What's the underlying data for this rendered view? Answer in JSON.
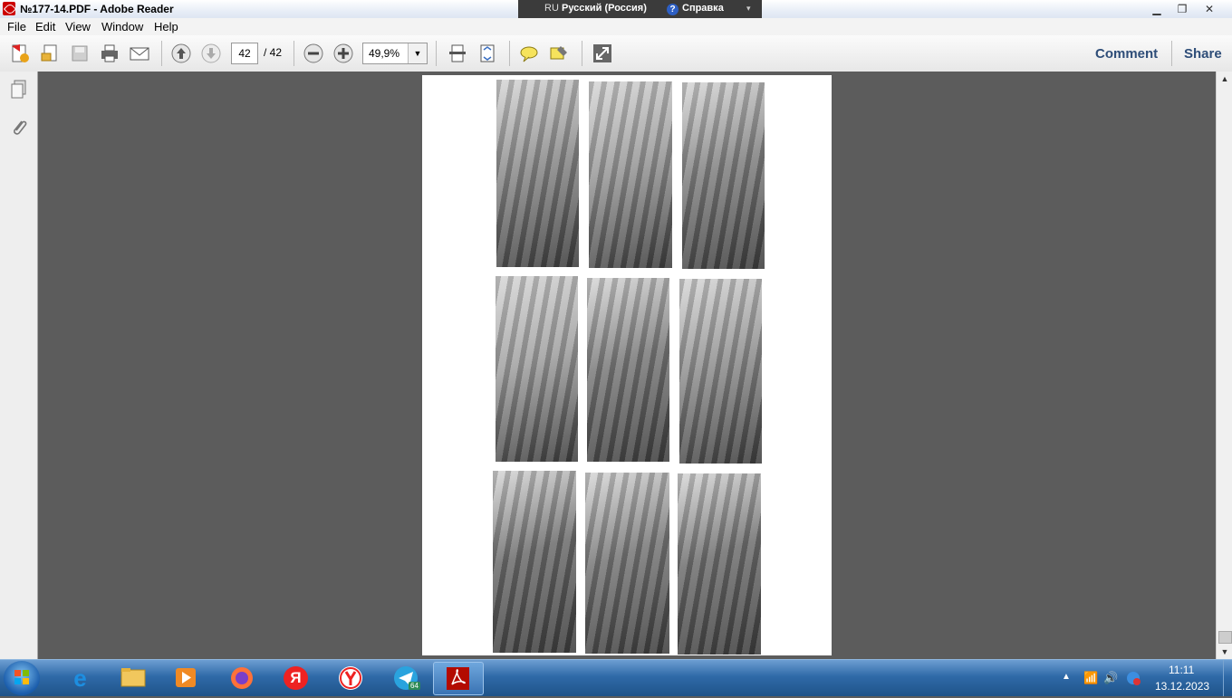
{
  "window": {
    "title": "№177-14.PDF - Adobe Reader",
    "language_code": "RU",
    "language_name": "Русский (Россия)",
    "help_label": "Справка"
  },
  "menu": [
    "File",
    "Edit",
    "View",
    "Window",
    "Help"
  ],
  "toolbar": {
    "current_page": "42",
    "page_total": "/ 42",
    "zoom": "49,9%",
    "comment_label": "Comment",
    "share_label": "Share"
  },
  "photos": [
    {
      "subject": "bus-interior-seats",
      "tone": "#8d8d8d"
    },
    {
      "subject": "metal-plate",
      "tone": "#9a9a9a"
    },
    {
      "subject": "bus-interior-seats",
      "tone": "#848484"
    },
    {
      "subject": "driver-cabin",
      "tone": "#a2a2a2"
    },
    {
      "subject": "engine-bay",
      "tone": "#7d7d7d"
    },
    {
      "subject": "door-panel",
      "tone": "#929292"
    },
    {
      "subject": "bus-exterior-side",
      "tone": "#6f6f6f"
    },
    {
      "subject": "bus-exterior-rear",
      "tone": "#7a7a7a"
    },
    {
      "subject": "bus-exterior-front",
      "tone": "#727272"
    }
  ],
  "taskbar": {
    "apps": [
      "windows-explorer",
      "ie",
      "folder",
      "media-player",
      "firefox",
      "yandex-ya",
      "yandex-browser",
      "telegram",
      "adobe-reader"
    ],
    "yandex_letter": "Я",
    "telegram_badge": "64",
    "time": "11:11",
    "date": "13.12.2023"
  },
  "colors": {
    "doc_background": "#5c5c5c",
    "link": "#2e4d78",
    "taskbar": "#2f6aa8"
  }
}
